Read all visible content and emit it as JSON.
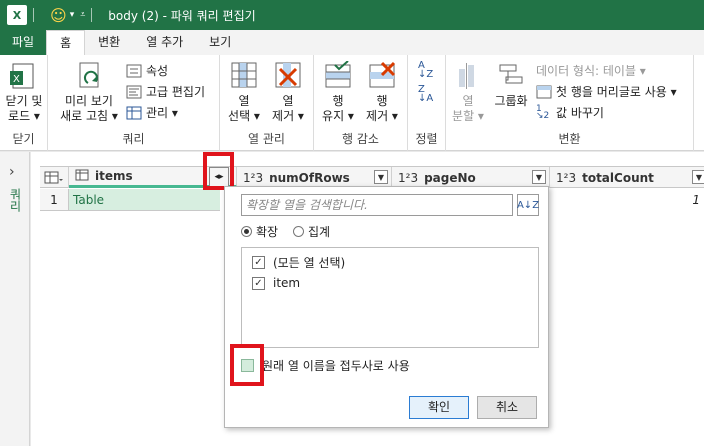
{
  "window": {
    "title": "body (2) - 파워 쿼리 편집기",
    "app_icon": "X",
    "qat_icon": "smiley-icon"
  },
  "tabs": [
    {
      "label": "파일"
    },
    {
      "label": "홈"
    },
    {
      "label": "변환"
    },
    {
      "label": "열 추가"
    },
    {
      "label": "보기"
    }
  ],
  "ribbon": {
    "close": {
      "label1": "닫기 및",
      "label2": "로드 ▾",
      "group": "닫기"
    },
    "query": {
      "preview_label1": "미리 보기",
      "preview_label2": "새로 고침 ▾",
      "properties": "속성",
      "advanced_editor": "고급 편집기",
      "manage": "관리 ▾",
      "group": "쿼리"
    },
    "columns": {
      "choose1": "열",
      "choose2": "선택 ▾",
      "remove1": "열",
      "remove2": "제거 ▾",
      "group": "열 관리"
    },
    "rows": {
      "keep1": "행",
      "keep2": "유지 ▾",
      "remove1": "행",
      "remove2": "제거 ▾",
      "group": "행 감소"
    },
    "sort": {
      "group": "정렬"
    },
    "transform": {
      "split1": "열",
      "split2": "분할 ▾",
      "groupby": "그룹화",
      "datatype": "데이터 형식: 테이블 ▾",
      "first_row_header": "첫 행을 머리글로 사용 ▾",
      "replace_values": "값 바꾸기",
      "group": "변환"
    }
  },
  "nav": {
    "label": "쿼리"
  },
  "grid": {
    "columns": [
      {
        "type_icon": "table",
        "name": "items"
      },
      {
        "type_icon": "1²3",
        "name": "numOfRows"
      },
      {
        "type_icon": "1²3",
        "name": "pageNo"
      },
      {
        "type_icon": "1²3",
        "name": "totalCount"
      }
    ],
    "rows": [
      {
        "num": "1",
        "items": "Table",
        "totalCount": "1"
      }
    ]
  },
  "popup": {
    "search_placeholder": "확장할 열을 검색합니다.",
    "radio_expand": "확장",
    "radio_aggregate": "집계",
    "items": [
      {
        "label": "(모든 열 선택)",
        "checked": true
      },
      {
        "label": "item",
        "checked": true
      }
    ],
    "prefix_label": "원래 열 이름을 접두사로 사용",
    "ok": "확인",
    "cancel": "취소"
  },
  "colors": {
    "excel_green": "#217346",
    "highlight_red": "#e0141c",
    "selected_col": "#47b891"
  }
}
